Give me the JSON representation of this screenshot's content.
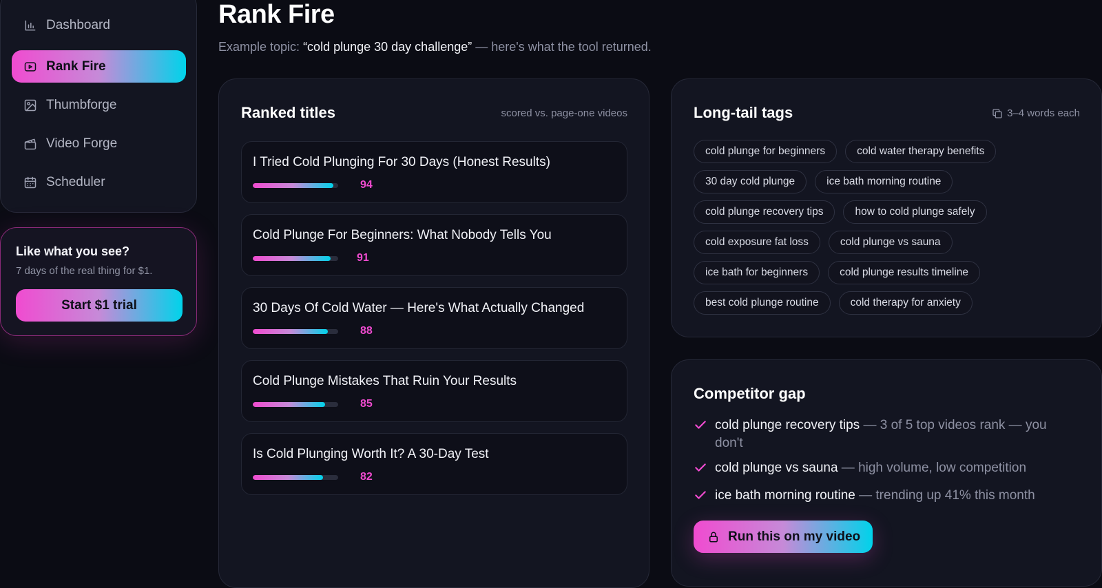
{
  "sidebar": {
    "items": [
      {
        "label": "Dashboard",
        "icon": "bar-chart-icon"
      },
      {
        "label": "Rank Fire",
        "icon": "play-icon",
        "active": true
      },
      {
        "label": "Thumbforge",
        "icon": "image-icon"
      },
      {
        "label": "Video Forge",
        "icon": "clapperboard-icon"
      },
      {
        "label": "Scheduler",
        "icon": "calendar-icon"
      }
    ]
  },
  "promo": {
    "title": "Like what you see?",
    "subtitle": "7 days of the real thing for $1.",
    "button_label": "Start $1 trial"
  },
  "header": {
    "title": "Rank Fire",
    "subtitle_prefix": "Example topic: ",
    "topic": "“cold plunge 30 day challenge”",
    "subtitle_suffix": " — here's what the tool returned."
  },
  "ranked_titles": {
    "title": "Ranked titles",
    "meta": "scored vs. page-one videos",
    "items": [
      {
        "text": "I Tried Cold Plunging For 30 Days (Honest Results)",
        "score": "94",
        "fill": 0.94
      },
      {
        "text": "Cold Plunge For Beginners: What Nobody Tells You",
        "score": "91",
        "fill": 0.91
      },
      {
        "text": "30 Days Of Cold Water — Here's What Actually Changed",
        "score": "88",
        "fill": 0.88
      },
      {
        "text": "Cold Plunge Mistakes That Ruin Your Results",
        "score": "85",
        "fill": 0.85
      },
      {
        "text": "Is Cold Plunging Worth It? A 30-Day Test",
        "score": "82",
        "fill": 0.82
      }
    ]
  },
  "long_tail": {
    "title": "Long-tail tags",
    "meta": "3–4 words each",
    "meta_icon": "copy-icon",
    "rows": [
      [
        "cold plunge for beginners",
        "cold water therapy benefits"
      ],
      [
        "30 day cold plunge",
        "ice bath morning routine"
      ],
      [
        "cold plunge recovery tips",
        "how to cold plunge safely"
      ],
      [
        "cold exposure fat loss",
        "cold plunge vs sauna"
      ],
      [
        "ice bath for beginners",
        "cold plunge results timeline"
      ],
      [
        "best cold plunge routine",
        "cold therapy for anxiety"
      ]
    ]
  },
  "competitor_gap": {
    "title": "Competitor gap",
    "items": [
      {
        "keyword": "cold plunge recovery tips",
        "note": " — 3 of 5 top videos rank — you don't"
      },
      {
        "keyword": "cold plunge vs sauna",
        "note": " — high volume, low competition"
      },
      {
        "keyword": "ice bath morning routine",
        "note": " — trending up 41% this month"
      }
    ],
    "button_label": "Run this on my video",
    "button_icon": "lock-icon"
  },
  "colors": {
    "accent_pink": "#f04bd0",
    "accent_cyan": "#00d3ea",
    "background": "#0b0c14",
    "panel": "#131521"
  }
}
